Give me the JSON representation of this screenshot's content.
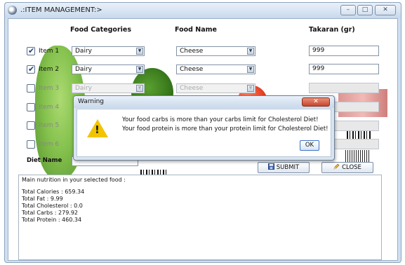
{
  "window": {
    "title": ".:ITEM MANAGEMENT:>",
    "minimize": "–",
    "maximize": "□",
    "close": "✕"
  },
  "columns": {
    "food_categories": "Food Categories",
    "food_name": "Food Name",
    "takaran": "Takaran (gr)"
  },
  "rows": [
    {
      "label": "Item 1",
      "checked": true,
      "category": "Dairy",
      "food": "Cheese",
      "amount": "999",
      "enabled": true
    },
    {
      "label": "Item 2",
      "checked": true,
      "category": "Dairy",
      "food": "Cheese",
      "amount": "999",
      "enabled": true
    },
    {
      "label": "Item 3",
      "checked": false,
      "category": "Dairy",
      "food": "Cheese",
      "amount": "",
      "enabled": false
    },
    {
      "label": "Item 4",
      "checked": false,
      "category": "",
      "food": "",
      "amount": "",
      "enabled": false
    },
    {
      "label": "Item 5",
      "checked": false,
      "category": "",
      "food": "",
      "amount": "",
      "enabled": false
    },
    {
      "label": "Item 6",
      "checked": false,
      "category": "",
      "food": "",
      "amount": "",
      "enabled": false
    }
  ],
  "diet": {
    "label": "Diet Name"
  },
  "buttons": {
    "submit": "SUBMIT",
    "close": "CLOSE"
  },
  "output": {
    "header": "Main nutrition in your selected food :",
    "lines": [
      "Total Calories : 659.34",
      "Total Fat : 9.99",
      "Total Cholesterol : 0.0",
      "Total Carbs : 279.92",
      "Total Protein : 460.34"
    ]
  },
  "dialog": {
    "title": "Warning",
    "close": "✕",
    "message_1": "Your food carbs is more than your carbs limit for Cholesterol Diet!",
    "message_2": "Your food protein is more than your protein limit for Cholesterol Diet!",
    "ok": "OK"
  },
  "colors": {
    "window_frame": "#cfdff0",
    "dialog_close": "#c6452b",
    "warning_icon": "#f2c400"
  }
}
